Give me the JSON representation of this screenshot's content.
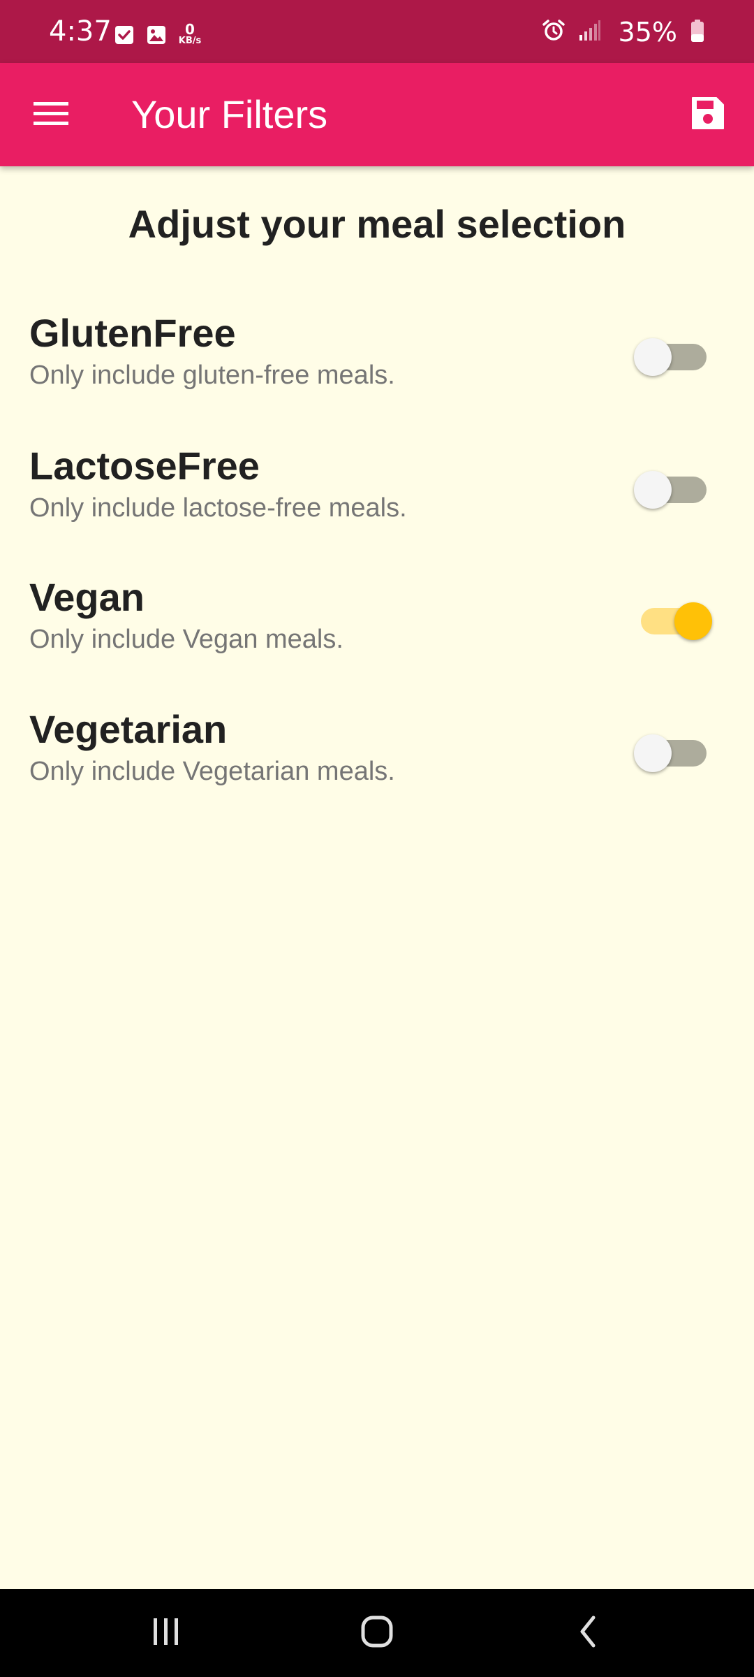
{
  "status_bar": {
    "time": "4:37",
    "net_speed_value": "0",
    "net_speed_unit": "KB/s",
    "battery_percent": "35%",
    "icons": [
      "checkbox-icon",
      "image-icon",
      "alarm-icon",
      "signal-icon",
      "battery-icon"
    ]
  },
  "app_bar": {
    "title": "Your Filters",
    "menu_icon": "menu-icon",
    "save_icon": "save-icon",
    "color": "#E91E63"
  },
  "heading": "Adjust your meal selection",
  "filters": [
    {
      "title": "GlutenFree",
      "subtitle": "Only include gluten-free meals.",
      "enabled": false
    },
    {
      "title": "LactoseFree",
      "subtitle": "Only include lactose-free meals.",
      "enabled": false
    },
    {
      "title": "Vegan",
      "subtitle": "Only include Vegan meals.",
      "enabled": true
    },
    {
      "title": "Vegetarian",
      "subtitle": "Only include Vegetarian meals.",
      "enabled": false
    }
  ],
  "nav_bar": {
    "icons": [
      "recents-icon",
      "home-icon",
      "back-icon"
    ]
  },
  "colors": {
    "status_bar": "#AD1848",
    "background": "#FFFDE7",
    "switch_on": "#FFC107",
    "switch_off_track": "#ADAC9C"
  }
}
